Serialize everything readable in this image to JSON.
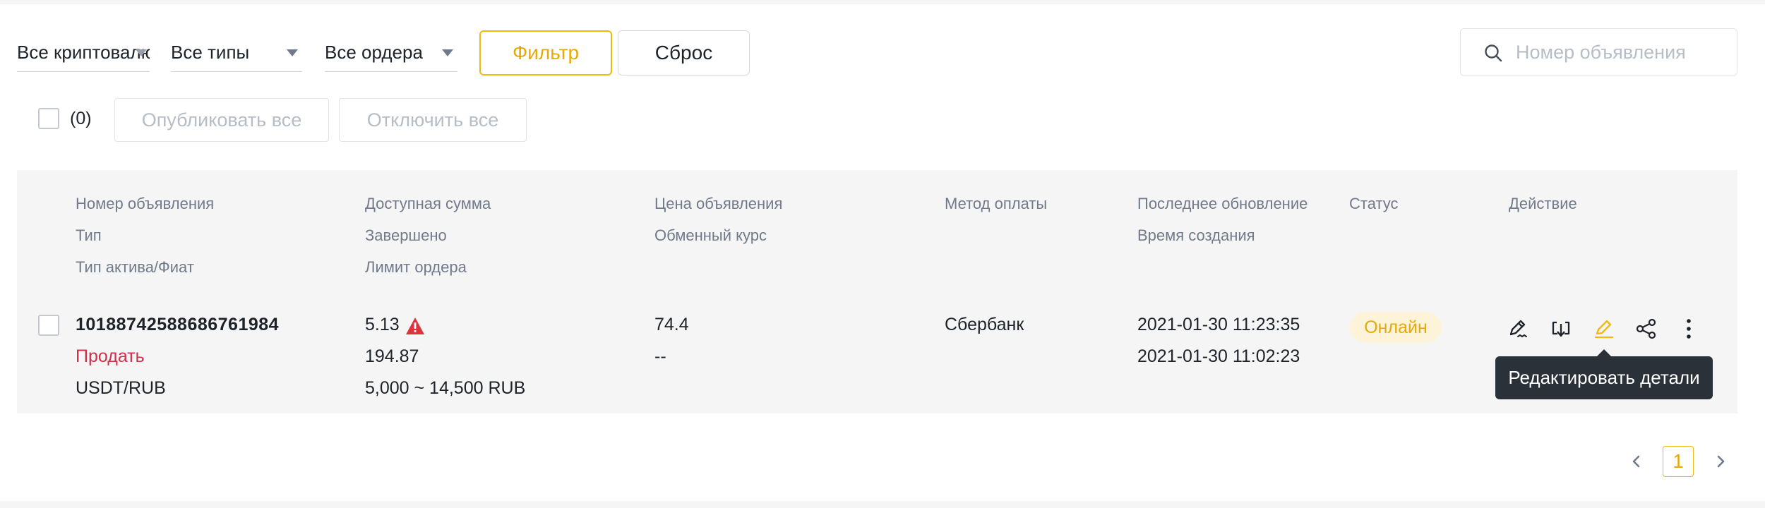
{
  "filters": {
    "crypto_dropdown": "Все криптовалюты",
    "types_dropdown": "Все типы",
    "orders_dropdown": "Все ордера",
    "filter_button": "Фильтр",
    "reset_button": "Сброс",
    "search_placeholder": "Номер объявления"
  },
  "bulk": {
    "selected_count": "(0)",
    "publish_all": "Опубликовать все",
    "disable_all": "Отключить все"
  },
  "table": {
    "headers": {
      "ad_number": "Номер объявления",
      "type": "Тип",
      "asset_fiat": "Тип актива/Фиат",
      "available": "Доступная сумма",
      "completed": "Завершено",
      "order_limit": "Лимит ордера",
      "price": "Цена объявления",
      "exchange_rate": "Обменный курс",
      "payment_method": "Метод оплаты",
      "last_update": "Последнее обновление",
      "created_time": "Время создания",
      "status": "Статус",
      "action": "Действие"
    },
    "rows": [
      {
        "ad_number": "10188742588686761984",
        "type": "Продать",
        "asset_fiat": "USDT/RUB",
        "available": "5.13",
        "completed": "194.87",
        "order_limit": "5,000 ~ 14,500 RUB",
        "price": "74.4",
        "exchange_rate": "--",
        "payment_method": "Сбербанк",
        "last_update": "2021-01-30 11:23:35",
        "created_time": "2021-01-30 11:02:23",
        "status": "Онлайн"
      }
    ]
  },
  "tooltip": "Редактировать детали",
  "pagination": {
    "current_page": "1"
  },
  "colors": {
    "accent": "#f0b90b",
    "sell": "#cf304a",
    "warning": "#e0323c",
    "tooltip_bg": "#2b3139"
  }
}
